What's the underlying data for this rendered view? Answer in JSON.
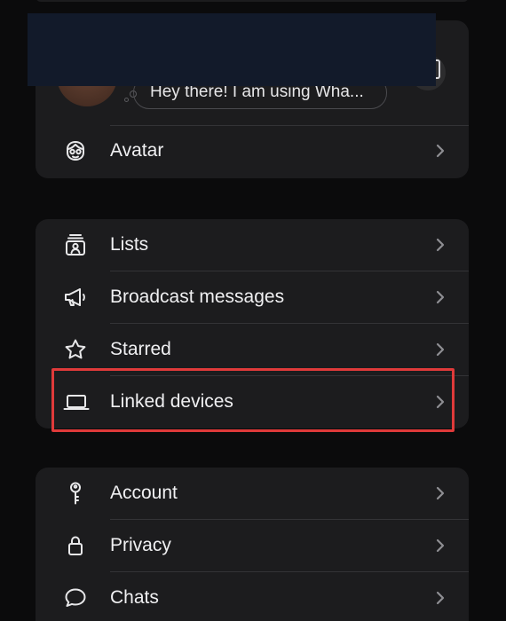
{
  "profile": {
    "status_text": "Hey there! I am using Wha..."
  },
  "profile_card": {
    "avatar_row": {
      "label": "Avatar",
      "icon": "avatar-face-icon"
    }
  },
  "group_a": {
    "items": [
      {
        "label": "Lists",
        "icon": "lists-icon"
      },
      {
        "label": "Broadcast messages",
        "icon": "megaphone-icon"
      },
      {
        "label": "Starred",
        "icon": "star-icon"
      },
      {
        "label": "Linked devices",
        "icon": "laptop-icon"
      }
    ]
  },
  "group_b": {
    "items": [
      {
        "label": "Account",
        "icon": "key-icon"
      },
      {
        "label": "Privacy",
        "icon": "lock-icon"
      },
      {
        "label": "Chats",
        "icon": "chat-bubble-icon"
      }
    ]
  },
  "colors": {
    "background": "#0b0b0c",
    "card": "#1c1c1e",
    "divider": "#333336",
    "highlight": "#e03a3a",
    "redaction": "#121a2a"
  }
}
